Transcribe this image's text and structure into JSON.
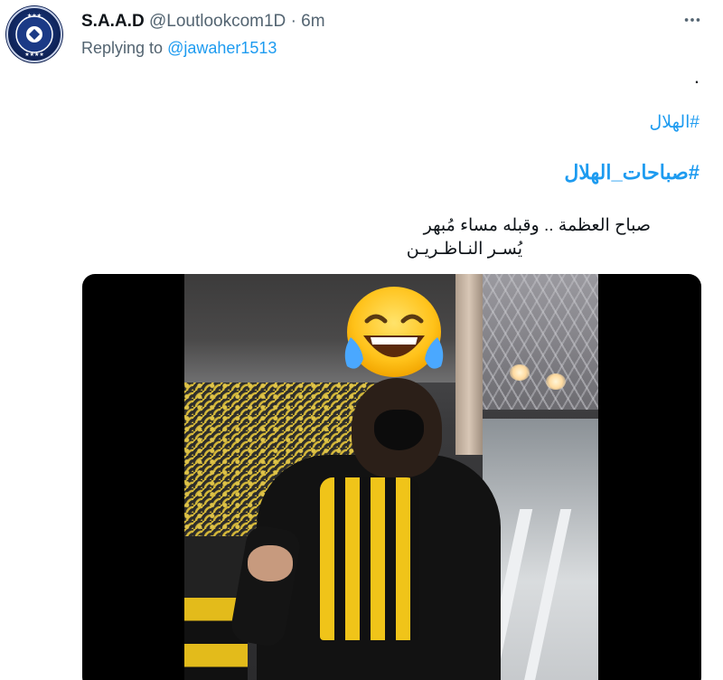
{
  "author": {
    "name": "S.A.A.D",
    "handle": "@Loutlookcom1D",
    "separator": "·",
    "time": "6m"
  },
  "reply": {
    "prefix": "Replying to ",
    "mention": "@jawaher1513"
  },
  "tweet": {
    "dot": ".",
    "hashtag_1": "#الهلال",
    "hashtag_2": "#صباحات_الهلال",
    "line_1": "صباح العظمة .. وقبله مساء مُبهر",
    "line_2": "يُسـر النـاظـريـن"
  },
  "icons": {
    "more": "more-icon",
    "avatar": "club-logo-icon",
    "overlay": "face-with-tears-of-joy-emoji"
  },
  "colors": {
    "link": "#1d9bf0",
    "secondary_text": "#536471",
    "primary_text": "#0f1419",
    "media_background": "#000000"
  }
}
